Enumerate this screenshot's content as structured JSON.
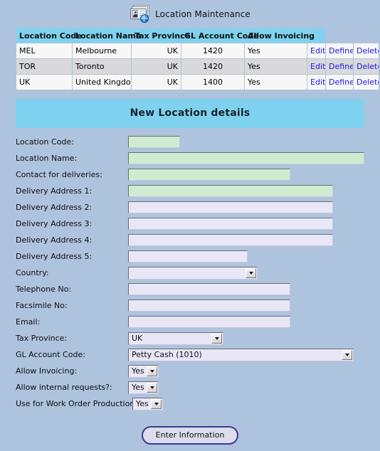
{
  "page": {
    "title": "Location Maintenance",
    "icon": "location-card-globe-icon",
    "background_color": "#aec3de",
    "accent_color": "#7fd2ef",
    "link_color": "#1f17e8",
    "required_field_color": "#d0ecd0",
    "field_color": "#e8e6f7"
  },
  "listing": {
    "columns": [
      "Location Code",
      "Location Name",
      "Tax Province",
      "GL Account Code",
      "Allow Invoicing",
      ""
    ],
    "actions": [
      "Edit",
      "Define",
      "Delete"
    ],
    "rows": [
      {
        "location_code": "MEL",
        "location_name": "Melbourne",
        "tax_province": "UK",
        "gl_account_code": "1420",
        "allow_invoicing": "Yes",
        "edit": "Edit",
        "define": "Define",
        "delete": "Delete"
      },
      {
        "location_code": "TOR",
        "location_name": "Toronto",
        "tax_province": "UK",
        "gl_account_code": "1420",
        "allow_invoicing": "Yes",
        "edit": "Edit",
        "define": "Define",
        "delete": "Delete"
      },
      {
        "location_code": "UK",
        "location_name": "United Kingdom",
        "tax_province": "UK",
        "gl_account_code": "1400",
        "allow_invoicing": "Yes",
        "edit": "Edit",
        "define": "Define",
        "delete": "Delete"
      }
    ]
  },
  "form": {
    "heading": "New Location details",
    "fields": {
      "location_code": {
        "label": "Location Code:",
        "value": ""
      },
      "location_name": {
        "label": "Location Name:",
        "value": ""
      },
      "contact_for_deliveries": {
        "label": "Contact for deliveries:",
        "value": ""
      },
      "delivery_address_1": {
        "label": "Delivery Address 1:",
        "value": ""
      },
      "delivery_address_2": {
        "label": "Delivery Address 2:",
        "value": ""
      },
      "delivery_address_3": {
        "label": "Delivery Address 3:",
        "value": ""
      },
      "delivery_address_4": {
        "label": "Delivery Address 4:",
        "value": ""
      },
      "delivery_address_5": {
        "label": "Delivery Address 5:",
        "value": ""
      },
      "country": {
        "label": "Country:",
        "value": ""
      },
      "telephone_no": {
        "label": "Telephone No:",
        "value": ""
      },
      "facsimile_no": {
        "label": "Facsimile No:",
        "value": ""
      },
      "email": {
        "label": "Email:",
        "value": ""
      },
      "tax_province": {
        "label": "Tax Province:",
        "value": "UK"
      },
      "gl_account_code": {
        "label": "GL Account Code:",
        "value": "Petty Cash (1010)"
      },
      "allow_invoicing": {
        "label": "Allow Invoicing:",
        "value": "Yes"
      },
      "allow_internal_requests": {
        "label": "Allow internal requests?:",
        "value": "Yes"
      },
      "use_for_work_order_productions": {
        "label": "Use for Work Order Productions?:",
        "value": "Yes"
      }
    },
    "submit_label": "Enter Information"
  }
}
